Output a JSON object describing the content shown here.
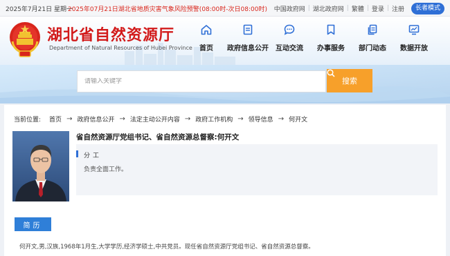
{
  "topbar": {
    "date": "2025年7月21日 星期一",
    "alert": "2025年07月21日湖北省地质灾害气象风险预警(08:00时-次日08:00时)",
    "links": [
      "中国政府网",
      "湖北政府网",
      "繁體",
      "登录",
      "注册"
    ],
    "elder_mode": "长者模式"
  },
  "header": {
    "title": "湖北省自然资源厅",
    "subtitle": "Department of Natural Resources of Hubei Province",
    "nav": [
      {
        "label": "首页",
        "icon": "home-icon"
      },
      {
        "label": "政府信息公开",
        "icon": "document-icon"
      },
      {
        "label": "互动交流",
        "icon": "chat-icon"
      },
      {
        "label": "办事服务",
        "icon": "bookmark-icon"
      },
      {
        "label": "部门动态",
        "icon": "files-icon"
      },
      {
        "label": "数据开放",
        "icon": "monitor-icon"
      }
    ]
  },
  "search": {
    "placeholder": "请输入关键字",
    "button": "搜索"
  },
  "breadcrumb": {
    "prefix": "当前位置:",
    "items": [
      "首页",
      "政府信息公开",
      "法定主动公开内容",
      "政府工作机构",
      "领导信息",
      "何开文"
    ]
  },
  "leader": {
    "title": "省自然资源厅党组书记、省自然资源总督察:何开文",
    "duty_label": "分工",
    "duty_text": "负责全面工作。",
    "resume_tab": "简历",
    "resume_text": "何开文,男,汉族,1968年1月生,大学学历,经济学硕士,中共党员。现任省自然资源厅党组书记、省自然资源总督察。"
  },
  "colors": {
    "brand_red": "#d21a1a",
    "accent_blue": "#2f6fd6",
    "search_orange": "#f7a02a"
  }
}
